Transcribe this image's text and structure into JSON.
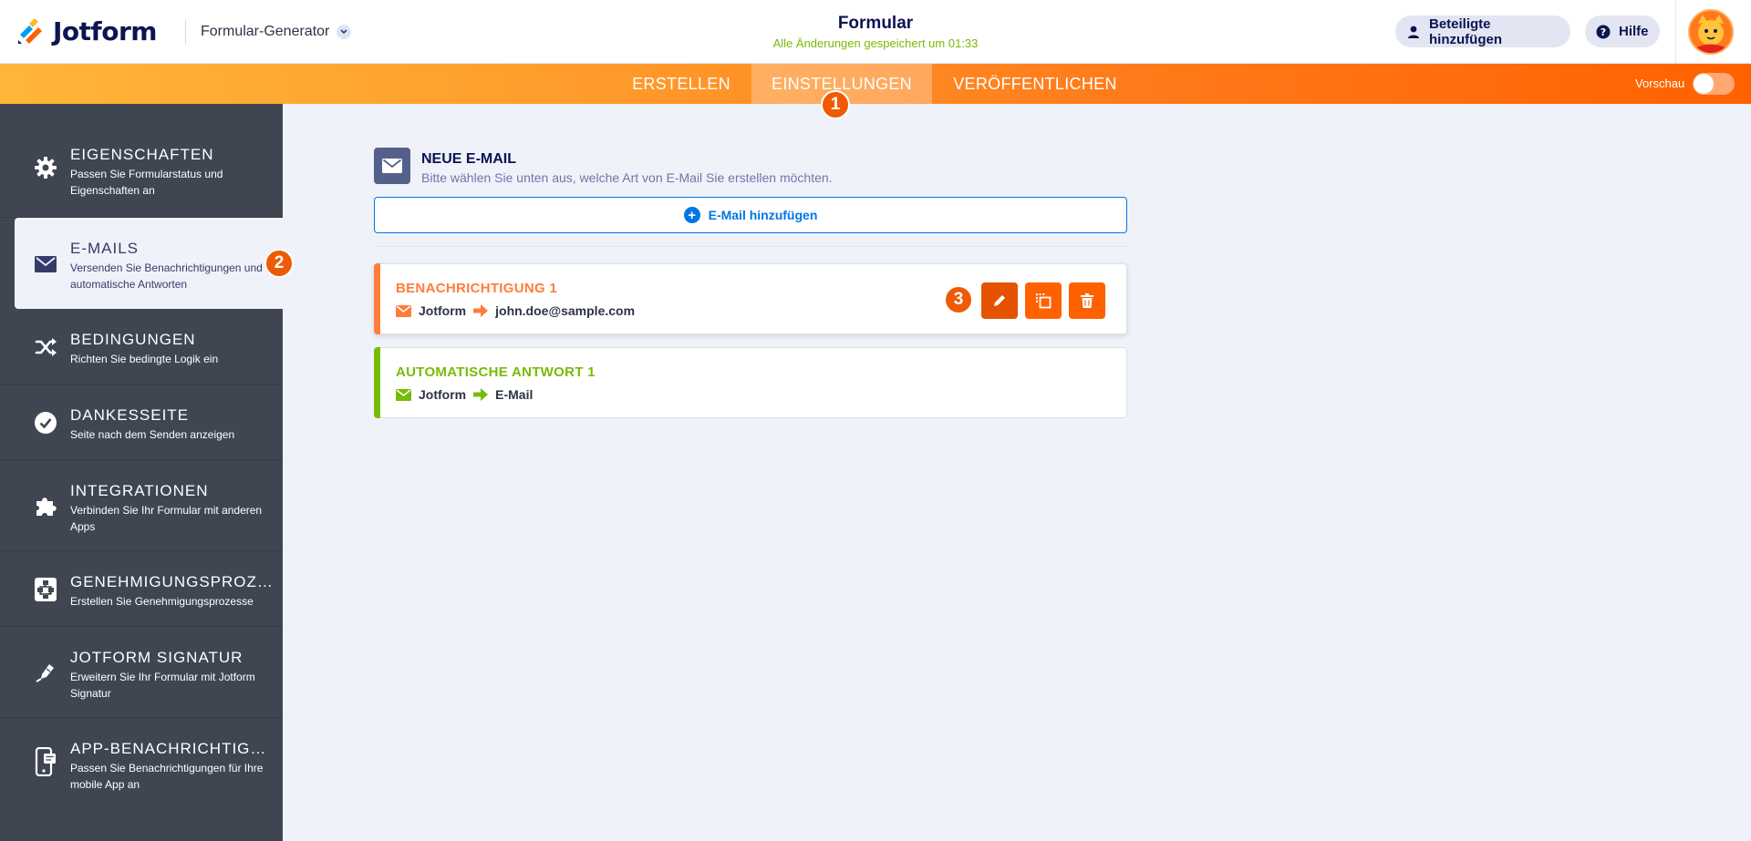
{
  "header": {
    "logo_text": "Jotform",
    "builder_label": "Formular-Generator",
    "form_title": "Formular",
    "save_status": "Alle Änderungen gespeichert um 01:33",
    "invite_label": "Beteiligte hinzufügen",
    "help_label": "Hilfe"
  },
  "nav": {
    "tabs": [
      {
        "label": "ERSTELLEN"
      },
      {
        "label": "EINSTELLUNGEN"
      },
      {
        "label": "VERÖFFENTLICHEN"
      }
    ],
    "active_tab": "EINSTELLUNGEN",
    "preview_label": "Vorschau",
    "preview_on": false
  },
  "steps": [
    "1",
    "2",
    "3"
  ],
  "sidebar": {
    "items": [
      {
        "title": "EIGENSCHAFTEN",
        "desc": "Passen Sie Formularstatus und Eigenschaften an",
        "icon": "gear-icon"
      },
      {
        "title": "E-MAILS",
        "desc": "Versenden Sie Benachrichtigungen und automatische Antworten",
        "icon": "envelope-icon"
      },
      {
        "title": "BEDINGUNGEN",
        "desc": "Richten Sie bedingte Logik ein",
        "icon": "shuffle-icon"
      },
      {
        "title": "DANKESSEITE",
        "desc": "Seite nach dem Senden anzeigen",
        "icon": "check-circle-icon"
      },
      {
        "title": "INTEGRATIONEN",
        "desc": "Verbinden Sie Ihr Formular mit anderen Apps",
        "icon": "puzzle-icon"
      },
      {
        "title": "GENEHMIGUNGSPROZES...",
        "desc": "Erstellen Sie Genehmigungsprozesse",
        "icon": "workflow-icon"
      },
      {
        "title": "JOTFORM SIGNATUR",
        "desc": "Erweitern Sie Ihr Formular mit Jotform Signatur",
        "icon": "pen-icon"
      },
      {
        "title": "APP-BENACHRICHTIGUNG",
        "desc": "Passen Sie Benachrichtigungen für Ihre mobile App an",
        "icon": "mobile-icon"
      }
    ],
    "active_item": "E-MAILS"
  },
  "main": {
    "new_email_title": "NEUE E-MAIL",
    "new_email_sub": "Bitte wählen Sie unten aus, welche Art von E-Mail Sie erstellen möchten.",
    "add_email_label": "E-Mail hinzufügen",
    "emails": [
      {
        "title": "BENACHRICHTIGUNG 1",
        "from": "Jotform",
        "to": "john.doe@sample.com",
        "color": "#ff7d3b"
      },
      {
        "title": "AUTOMATISCHE ANTWORT 1",
        "from": "Jotform",
        "to": "E-Mail",
        "color": "#78bb07"
      }
    ]
  },
  "colors": {
    "accent_orange": "#ff6100",
    "sidebar_bg": "#3f4652",
    "link_blue": "#0075e3",
    "success_green": "#78bb07"
  }
}
